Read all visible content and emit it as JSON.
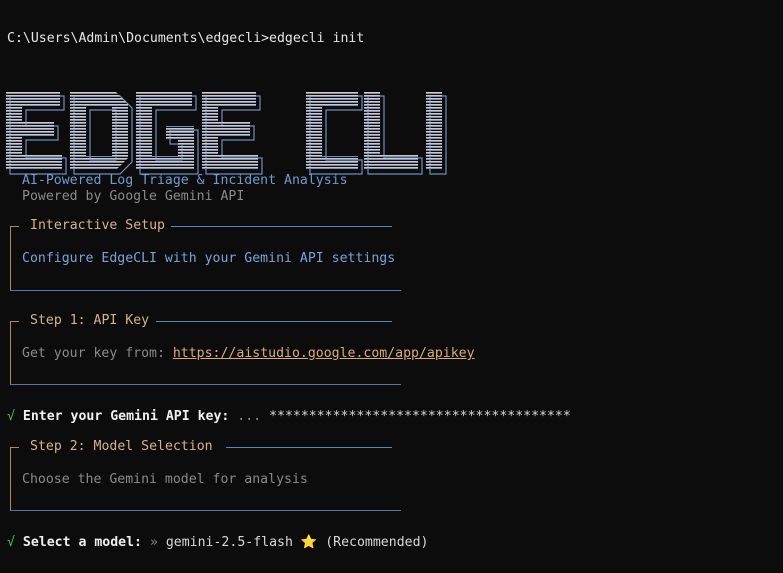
{
  "terminal": {
    "prompt": "C:\\Users\\Admin\\Documents\\edgecli>edgecli init"
  },
  "banner": {
    "text": "EDGE CLI",
    "gradient_top": "#e9c6a8",
    "gradient_bottom": "#3f73bc"
  },
  "tagline": "AI-Powered Log Triage & Incident Analysis",
  "powered_by": "Powered by Google Gemini API",
  "setup_box": {
    "title": "Interactive Setup",
    "body": "Configure EdgeCLI with your Gemini API settings"
  },
  "step1": {
    "title": "Step 1: API Key",
    "body_prefix": "Get your key from: ",
    "link": "https://aistudio.google.com/app/apikey"
  },
  "api_key_prompt": {
    "check": "√",
    "label": "Enter your Gemini API key:",
    "separator": "...",
    "masked_value": "**************************************"
  },
  "step2": {
    "title": "Step 2: Model Selection",
    "body": "Choose the Gemini model for analysis"
  },
  "model_prompt": {
    "check": "√",
    "label": "Select a model:",
    "chevron": "»",
    "value": "gemini-2.5-flash",
    "star": "⭐",
    "note": "(Recommended)"
  },
  "colors": {
    "background": "#0c0c0c",
    "accent_blue": "#7aa4d8",
    "accent_tan": "#d4b48e",
    "success_green": "#3fc95a"
  }
}
